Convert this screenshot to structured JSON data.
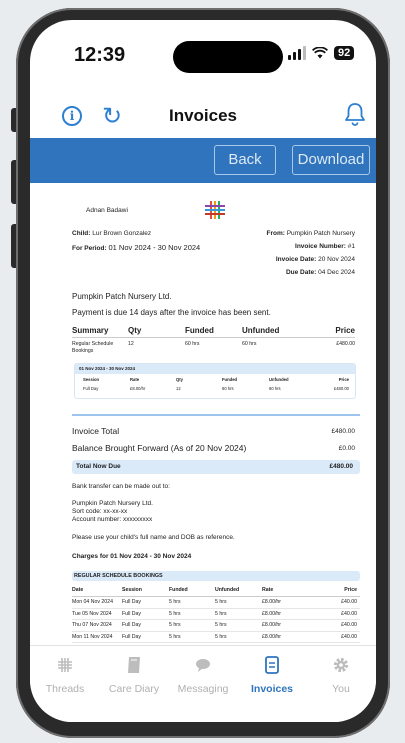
{
  "status": {
    "time": "12:39",
    "battery": "92"
  },
  "header": {
    "title": "Invoices"
  },
  "actions": {
    "back_label": "Back",
    "download_label": "Download"
  },
  "invoice": {
    "parent_name": "Adnan Badawi",
    "child_label": "Child:",
    "child_name": "Lur Brown Gonzalez",
    "from_label": "From:",
    "from_value": "Pumpkin Patch Nursery",
    "period_label": "For Period:",
    "period_value": "01 Nov 2024 - 30 Nov 2024",
    "invoice_number_label": "Invoice Number:",
    "invoice_number_value": "#1",
    "invoice_date_label": "Invoice Date:",
    "invoice_date_value": "20 Nov 2024",
    "due_date_label": "Due Date:",
    "due_date_value": "04 Dec 2024",
    "company": "Pumpkin Patch Nursery Ltd.",
    "payment_terms": "Payment is due 14 days after the invoice has been sent.",
    "summary_headers": [
      "Summary",
      "Qty",
      "Funded",
      "Unfunded",
      "Price"
    ],
    "summary_row": [
      "Regular Schedule",
      "12",
      "60 hrs",
      "60 hrs",
      "£480.00"
    ],
    "summary_row_extra": "Bookings",
    "sub_period": "01 Nov 2024 - 30 Nov 2024",
    "sub_headers": [
      "Session",
      "Rate",
      "Qty",
      "Funded",
      "Unfunded",
      "Price"
    ],
    "sub_row": [
      "Full Day",
      "£8.00/hr",
      "12",
      "60 hrs",
      "60 hrs",
      "£480.00"
    ],
    "invoice_total_label": "Invoice Total",
    "invoice_total_value": "£480.00",
    "balance_label": "Balance Brought Forward (As of 20 Nov 2024)",
    "balance_value": "£0.00",
    "total_due_label": "Total Now Due",
    "total_due_value": "£480.00",
    "bank_intro": "Bank transfer can be made out to:",
    "bank_name": "Pumpkin Patch Nursery Ltd.",
    "sort_code": "Sort code: xx-xx-xx",
    "account_number": "Account number: xxxxxxxxx",
    "reference_note": "Please use your child's full name and DOB as reference.",
    "charges_title": "Charges for 01 Nov 2024 - 30 Nov 2024",
    "bookings_title": "REGULAR SCHEDULE BOOKINGS",
    "charge_headers": [
      "Date",
      "Session",
      "Funded",
      "Unfunded",
      "Rate",
      "Price"
    ],
    "charge_rows": [
      [
        "Mon 04 Nov 2024",
        "Full Day",
        "5 hrs",
        "5 hrs",
        "£8.00/hr",
        "£40.00"
      ],
      [
        "Tue 05 Nov 2024",
        "Full Day",
        "5 hrs",
        "5 hrs",
        "£8.00/hr",
        "£40.00"
      ],
      [
        "Thu 07 Nov 2024",
        "Full Day",
        "5 hrs",
        "5 hrs",
        "£8.00/hr",
        "£40.00"
      ],
      [
        "Mon 11 Nov 2024",
        "Full Day",
        "5 hrs",
        "5 hrs",
        "£8.00/hr",
        "£40.00"
      ],
      [
        "Tue 12 Nov 2024",
        "Full Day",
        "5 hrs",
        "5 hrs",
        "£8.00/hr",
        "£40.00"
      ]
    ]
  },
  "tabs": [
    {
      "label": "Threads",
      "icon": "hashtag-icon"
    },
    {
      "label": "Care Diary",
      "icon": "book-icon"
    },
    {
      "label": "Messaging",
      "icon": "chat-bubble-icon"
    },
    {
      "label": "Invoices",
      "icon": "invoice-icon"
    },
    {
      "label": "You",
      "icon": "gear-icon"
    }
  ],
  "colors": {
    "accent": "#2f74bd",
    "icon_blue": "#2d7fd1",
    "highlight": "#dbeaf9"
  }
}
